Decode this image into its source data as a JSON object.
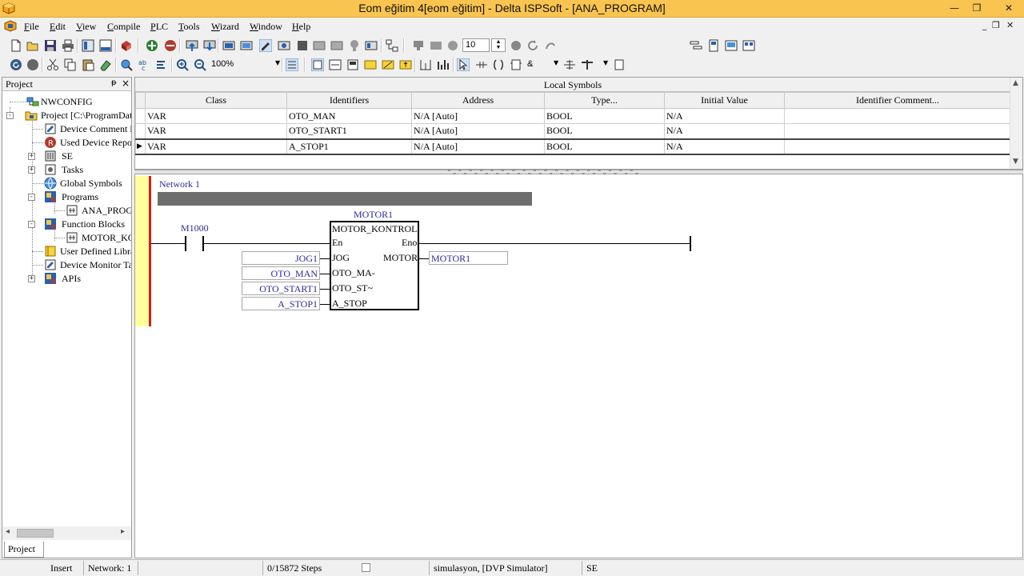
{
  "window": {
    "title": "Eom eğitim 4[eom eğitim] - Delta ISPSoft - [ANA_PROGRAM]",
    "controls": {
      "minimize": "—",
      "restore": "❐",
      "close": "✕"
    },
    "mdi_controls": {
      "minimize": "_",
      "restore": "❐",
      "close": "✕"
    }
  },
  "menu": {
    "items": [
      "File",
      "Edit",
      "View",
      "Compile",
      "PLC",
      "Tools",
      "Wizard",
      "Window",
      "Help"
    ]
  },
  "toolbar": {
    "scan_value": "10",
    "zoom": "100%",
    "and_symbol": "&"
  },
  "project_panel": {
    "title": "Project",
    "pin": "ᵽ",
    "close": "×",
    "tab": "Project",
    "tree": [
      {
        "label": "NWCONFIG",
        "icon": "network-config-icon"
      },
      {
        "label": "Project [C:\\ProgramData\\",
        "icon": "project-icon",
        "expander": "-"
      },
      {
        "label": "Device Comment L",
        "icon": "device-comment-icon"
      },
      {
        "label": "Used Device Repor",
        "icon": "device-report-icon"
      },
      {
        "label": "SE",
        "icon": "plc-se-icon",
        "expander": "+"
      },
      {
        "label": "Tasks",
        "icon": "tasks-icon",
        "expander": "+"
      },
      {
        "label": "Global Symbols",
        "icon": "global-symbols-icon"
      },
      {
        "label": "Programs",
        "icon": "programs-icon",
        "expander": "-"
      },
      {
        "label": "ANA_PROG",
        "icon": "program-icon"
      },
      {
        "label": "Function Blocks",
        "icon": "function-blocks-icon",
        "expander": "-"
      },
      {
        "label": "MOTOR_KO",
        "icon": "function-block-icon"
      },
      {
        "label": "User Defined Libra",
        "icon": "user-library-icon"
      },
      {
        "label": "Device Monitor Ta",
        "icon": "device-monitor-icon"
      },
      {
        "label": "APIs",
        "icon": "apis-icon",
        "expander": "+"
      }
    ]
  },
  "local_symbols": {
    "title": "Local Symbols",
    "columns": [
      "Class",
      "Identifiers",
      "Address",
      "Type...",
      "Initial Value",
      "Identifier Comment..."
    ],
    "rows": [
      [
        "VAR",
        "OTO_MAN",
        "N/A [Auto]",
        "BOOL",
        "N/A",
        ""
      ],
      [
        "VAR",
        "OTO_START1",
        "N/A [Auto]",
        "BOOL",
        "N/A",
        ""
      ],
      [
        "VAR",
        "A_STOP1",
        "N/A [Auto]",
        "BOOL",
        "N/A",
        ""
      ]
    ],
    "row_marker": "▶"
  },
  "ladder": {
    "network_label": "Network 1",
    "contact": "M1000",
    "fb_instance": "MOTOR1",
    "fb_type": "MOTOR_KONTROL",
    "inputs": [
      {
        "pin": "En",
        "var": ""
      },
      {
        "pin": "JOG",
        "var": "JOG1"
      },
      {
        "pin": "OTO_MA-",
        "var": "OTO_MAN"
      },
      {
        "pin": "OTO_ST~",
        "var": "OTO_START1"
      },
      {
        "pin": "A_STOP",
        "var": "A_STOP1"
      }
    ],
    "outputs": [
      {
        "pin": "Eno",
        "var": ""
      },
      {
        "pin": "MOTOR",
        "var": "MOTOR1"
      }
    ]
  },
  "status_bar": {
    "mode": "Insert",
    "network": "Network: 1",
    "steps": "0/15872 Steps",
    "connection": "simulasyon, [DVP Simulator]",
    "plc": "SE"
  }
}
